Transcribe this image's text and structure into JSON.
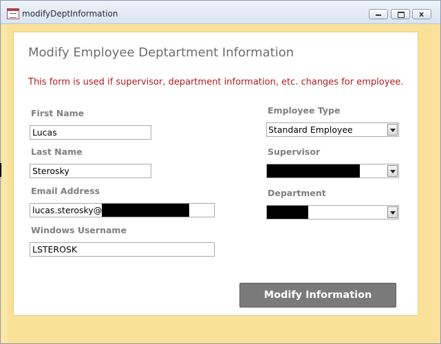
{
  "window": {
    "title": "modifyDeptInformation",
    "icons": {
      "app": "access-form-icon",
      "minimize": "minimize-icon",
      "restore": "restore-icon",
      "close": "close-icon"
    },
    "close_glyph": "x"
  },
  "form": {
    "title": "Modify Employee Deptartment Information",
    "description": "This form is used if supervisor, department information, etc. changes for employee.",
    "fields": {
      "first_name": {
        "label": "First Name",
        "value": "Lucas"
      },
      "last_name": {
        "label": "Last Name",
        "value": "Sterosky"
      },
      "email": {
        "label": "Email Address",
        "value_prefix": "lucas.sterosky@"
      },
      "windows_username": {
        "label": "Windows Username",
        "value": "LSTEROSK"
      },
      "employee_type": {
        "label": "Employee Type",
        "selected": "Standard Employee"
      },
      "supervisor": {
        "label": "Supervisor"
      },
      "department": {
        "label": "Department"
      }
    },
    "submit_label": "Modify Information"
  },
  "colors": {
    "background": "#f9e19a",
    "description_text": "#b01a1a",
    "label_text": "#7f7f7f",
    "button_bg": "#7a7a7a"
  }
}
